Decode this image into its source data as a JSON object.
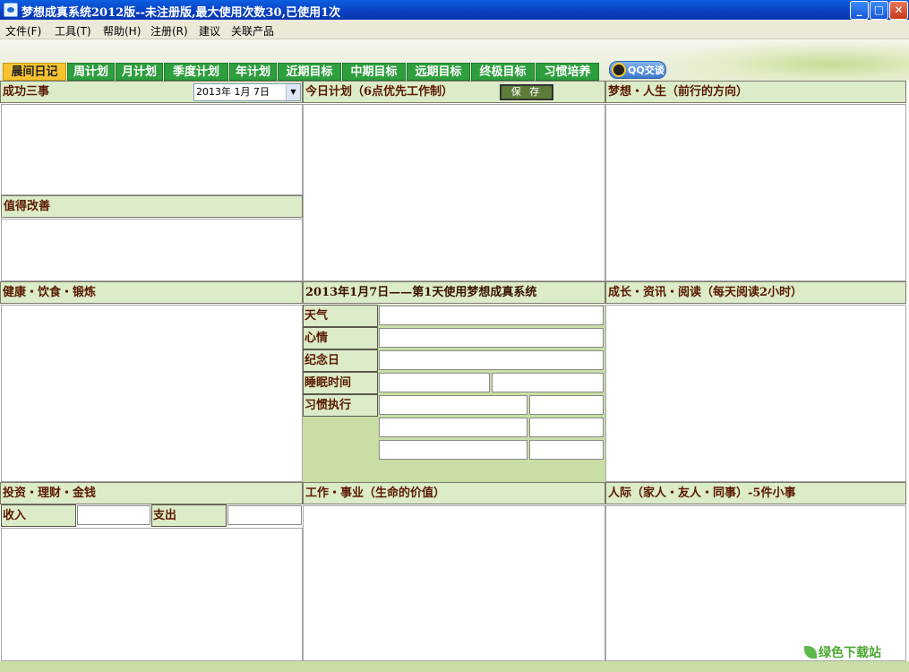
{
  "window": {
    "title": "梦想成真系统2012版--未注册版,最大使用次数30,已使用1次",
    "minimize": "_",
    "maximize": "□",
    "close": "✕"
  },
  "menu": [
    "文件(F)",
    "工具(T)",
    "帮助(H)",
    "注册(R)",
    "建议",
    "关联产品"
  ],
  "tabs": [
    "晨间日记",
    "周计划",
    "月计划",
    "季度计划",
    "年计划",
    "近期目标",
    "中期目标",
    "远期目标",
    "终极目标",
    "习惯培养"
  ],
  "qq_button": "QQ交谈",
  "sections": {
    "success": "成功三事",
    "improve": "值得改善",
    "today_plan": "今日计划（6点优先工作制）",
    "dream": "梦想・人生（前行的方向）",
    "health": "健康・饮食・锻炼",
    "day_info": "2013年1月7日——第1天使用梦想成真系统",
    "growth": "成长・资讯・阅读（每天阅读2小时）",
    "finance": "投资・理财・金钱",
    "career": "工作・事业（生命的价值）",
    "relations": "人际（家人・友人・同事）-5件小事"
  },
  "date_picker": "2013年 1月 7日",
  "save_button": "保 存",
  "day_fields": {
    "weather": "天气",
    "mood": "心情",
    "anniversary": "纪念日",
    "sleep": "睡眠时间",
    "habit": "习惯执行"
  },
  "finance_fields": {
    "income": "收入",
    "expense": "支出"
  },
  "watermark": "绿色下载站"
}
